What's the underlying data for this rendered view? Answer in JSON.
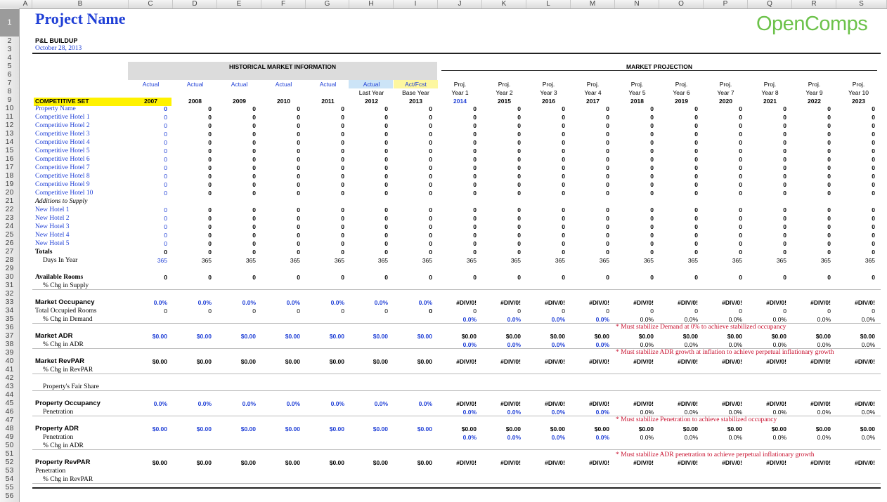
{
  "columns": [
    "A",
    "B",
    "C",
    "D",
    "E",
    "F",
    "G",
    "H",
    "I",
    "J",
    "K",
    "L",
    "M",
    "N",
    "O",
    "P",
    "Q",
    "R",
    "S"
  ],
  "rows": [
    "1",
    "2",
    "3",
    "4",
    "5",
    "6",
    "7",
    "8",
    "9",
    "10",
    "11",
    "12",
    "13",
    "14",
    "15",
    "16",
    "17",
    "18",
    "19",
    "20",
    "21",
    "22",
    "23",
    "24",
    "25",
    "26",
    "27",
    "28",
    "29",
    "30",
    "31",
    "32",
    "33",
    "34",
    "35",
    "36",
    "37",
    "38",
    "39",
    "40",
    "41",
    "42",
    "43",
    "44",
    "45",
    "46",
    "47",
    "48",
    "49",
    "50",
    "51",
    "52",
    "53",
    "54",
    "55",
    "56"
  ],
  "title": "Project Name",
  "subtitle": "P&L BUILDUP",
  "date": "October 28, 2013",
  "logo": "OpenComps",
  "historical_header": "HISTORICAL MARKET INFORMATION",
  "projection_header": "MARKET PROJECTION",
  "competitive_set_label": "COMPETITIVE SET",
  "col_headers": {
    "row7": [
      "Actual",
      "Actual",
      "Actual",
      "Actual",
      "Actual",
      "Actual",
      "Act/Fcst",
      "Proj.",
      "Proj.",
      "Proj.",
      "Proj.",
      "Proj.",
      "Proj.",
      "Proj.",
      "Proj.",
      "Proj.",
      "Proj."
    ],
    "row8": [
      "",
      "",
      "",
      "",
      "",
      "Last Year",
      "Base Year",
      "Year 1",
      "Year 2",
      "Year 3",
      "Year 4",
      "Year 5",
      "Year 6",
      "Year 7",
      "Year 8",
      "Year 9",
      "Year 10"
    ],
    "row9": [
      "2007",
      "2008",
      "2009",
      "2010",
      "2011",
      "2012",
      "2013",
      "2014",
      "2015",
      "2016",
      "2017",
      "2018",
      "2019",
      "2020",
      "2021",
      "2022",
      "2023"
    ]
  },
  "hotels": [
    "Property Name",
    "Competitive Hotel 1",
    "Competitive Hotel 2",
    "Competitive Hotel 3",
    "Competitive Hotel 4",
    "Competitive Hotel 5",
    "Competitive Hotel 6",
    "Competitive Hotel 7",
    "Competitive Hotel 8",
    "Competitive Hotel 9",
    "Competitive Hotel 10"
  ],
  "additions_label": "Additions to Supply",
  "new_hotels": [
    "New Hotel 1",
    "New Hotel 2",
    "New Hotel 3",
    "New Hotel 4",
    "New Hotel 5"
  ],
  "zero": "0",
  "totals_label": "Totals",
  "days_label": "Days In Year",
  "days_value": "365",
  "available_rooms_label": "Available Rooms",
  "chg_supply_label": "% Chg in Supply",
  "market_occ_label": "Market Occupancy",
  "total_occ_rooms_label": "Total Occupied Rooms",
  "chg_demand_label": "% Chg in Demand",
  "market_adr_label": "Market ADR",
  "chg_adr_label": "% Chg in ADR",
  "market_revpar_label": "Market RevPAR",
  "chg_revpar_label": "% Chg in RevPAR",
  "fair_share_label": "Property's Fair Share",
  "prop_occ_label": "Property Occupancy",
  "penetration_label": "Penetration",
  "prop_adr_label": "Property ADR",
  "prop_revpar_label": "Property RevPAR",
  "val_pct": "0.0%",
  "val_dollar": "$0.00",
  "val_div": "#DIV/0!",
  "notes": {
    "demand": "* Must stabilize Demand at 0% to achieve stabilized occupancy",
    "adr": "* Must stabilize ADR growth at inflation to achieve perpetual inflationary growth",
    "penetration": "* Must stabilize Penetration to achieve stabilized occupancy",
    "adr_pen": "* Must stabilize ADR penetration to achieve perpetual inflationary growth"
  }
}
